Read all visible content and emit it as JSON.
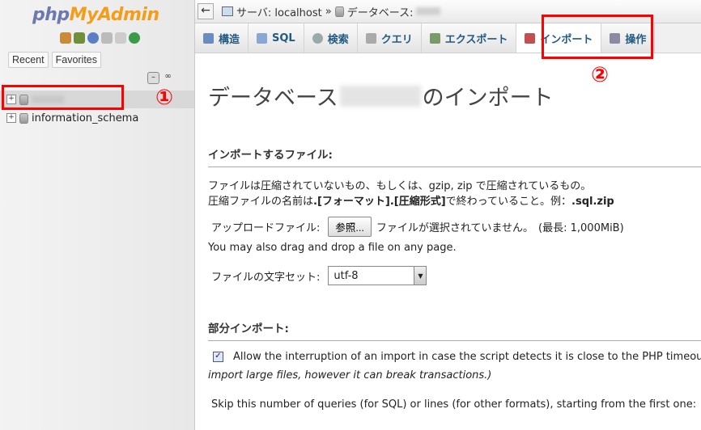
{
  "nav": {
    "logo_php": "php",
    "logo_myadmin": "MyAdmin",
    "recent_label": "Recent",
    "favorites_label": "Favorites",
    "databases": [
      {
        "name": ""
      },
      {
        "name": "information_schema"
      }
    ]
  },
  "breadcrumb": {
    "server_label": "サーバ: localhost",
    "separator": "»",
    "database_label": "データベース:"
  },
  "tabs": [
    {
      "label": "構造",
      "icon": "structure-icon"
    },
    {
      "label": "SQL",
      "icon": "sql-icon"
    },
    {
      "label": "検索",
      "icon": "search-icon"
    },
    {
      "label": "クエリ",
      "icon": "query-icon"
    },
    {
      "label": "エクスポート",
      "icon": "export-icon"
    },
    {
      "label": "インポート",
      "icon": "import-icon",
      "active": true
    },
    {
      "label": "操作",
      "icon": "operations-icon"
    }
  ],
  "annotations": {
    "marker1": "①",
    "marker2": "②"
  },
  "page": {
    "title_prefix": "データベース",
    "title_suffix": "のインポート"
  },
  "file_section": {
    "heading": "インポートするファイル:",
    "desc_line1": "ファイルは圧縮されていないもの、もしくは、gzip, zip で圧縮されているもの。",
    "desc_line2_pre": "圧縮ファイルの名前は",
    "desc_line2_bold1": ".[フォーマット].[圧縮形式]",
    "desc_line2_mid": "で終わっていること。例：",
    "desc_line2_bold2": ".sql.zip",
    "upload_label": "アップロードファイル:",
    "browse_label": "参照...",
    "no_file_text": "ファイルが選択されていません。",
    "max_size": "(最長: 1,000MiB)",
    "drag_text": "You may also drag and drop a file on any page.",
    "charset_label": "ファイルの文字セット:",
    "charset_value": "utf-8"
  },
  "partial_section": {
    "heading": "部分インポート:",
    "allow_text": "Allow the interruption of an import in case the script detects it is close to the PHP timeout",
    "allow_text_cont": "import large files, however it can break transactions.)",
    "allow_checked": true,
    "skip_text": "Skip this number of queries (for SQL) or lines (for other formats), starting from the first one:"
  },
  "colors": {
    "highlight": "#ff0000",
    "tab_text": "#235a81"
  }
}
